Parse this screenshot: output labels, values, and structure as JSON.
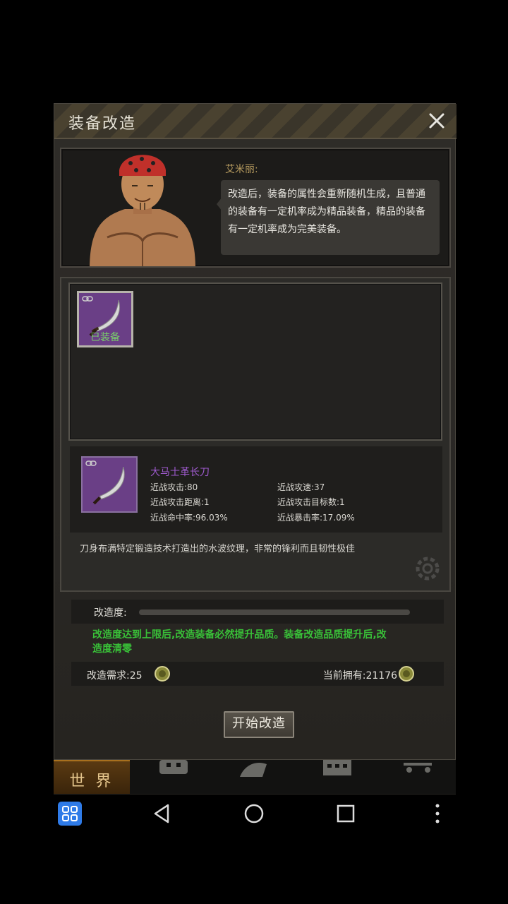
{
  "dialog": {
    "title": "装备改造",
    "close_icon": "close-icon"
  },
  "npc": {
    "name": "艾米丽:",
    "speech": "改造后，装备的属性会重新随机生成，且普通的装备有一定机率成为精品装备，精品的装备有一定机率成为完美装备。"
  },
  "inventory": {
    "slots": [
      {
        "item": "scimitar",
        "status": "已装备",
        "rarity_color": "#6a3f86"
      }
    ]
  },
  "item": {
    "name": "大马士革长刀",
    "name_color": "#a05bd0",
    "stats": {
      "melee_attack": "近战攻击:80",
      "melee_speed": "近战攻速:37",
      "melee_range": "近战攻击距离:1",
      "melee_targets": "近战攻击目标数:1",
      "melee_hit": "近战命中率:96.03%",
      "melee_crit": "近战暴击率:17.09%"
    },
    "description": "刀身布满特定锻造技术打造出的水波纹理，非常的锋利而且韧性极佳"
  },
  "modify": {
    "progress_label": "改造度:",
    "progress_value": 0,
    "hint": "改造度达到上限后,改造装备必然提升品质。装备改造品质提升后,改造度清零",
    "hint_color": "#39c038",
    "cost_label": "改造需求:25",
    "have_label": "当前拥有:21176",
    "currency_icon": "bottle-cap-icon",
    "start_button": "开始改造"
  },
  "bottom_nav": {
    "world_label": "世 界",
    "icons": [
      "backpack-icon",
      "character-icon",
      "building-icon",
      "cart-icon"
    ]
  },
  "system_nav": {
    "icons": [
      "app-grid-icon",
      "back-icon",
      "home-icon",
      "recents-icon",
      "more-icon"
    ]
  }
}
